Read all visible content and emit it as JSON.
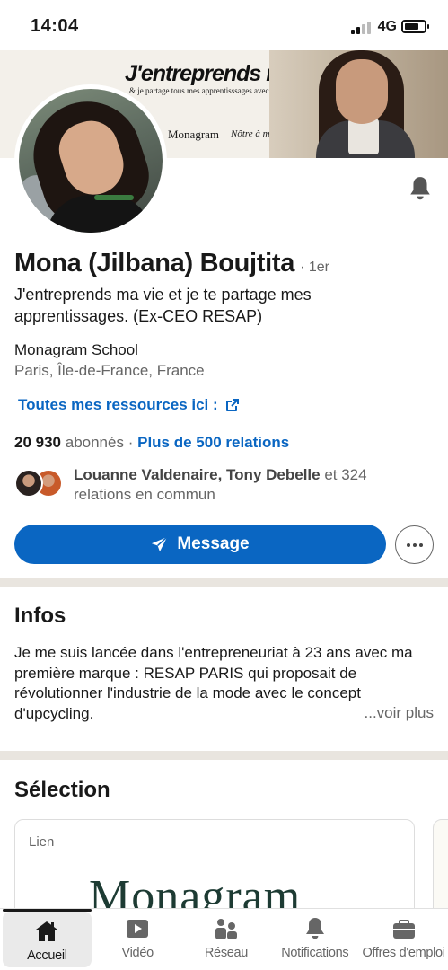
{
  "status_bar": {
    "time": "14:04",
    "network": "4G"
  },
  "banner": {
    "title": "J'entreprends ma vie.",
    "subtitle": "& je partage tous mes apprentisssages avec toi.",
    "brand": "Monagram",
    "handwriting": "Nôtre à moi-même"
  },
  "profile": {
    "name": "Mona (Jilbana) Boujtita",
    "degree": "· 1er",
    "headline": "J'entreprends ma vie et je te partage mes apprentissages. (Ex-CEO RESAP)",
    "company": "Monagram School",
    "location": "Paris, Île-de-France, France",
    "link_label": "Toutes mes ressources ici :",
    "followers_count": "20 930",
    "followers_label": "abonnés",
    "separator": "·",
    "connections": "Plus de 500 relations",
    "mutual_names": "Louanne Valdenaire, Tony Debelle",
    "mutual_suffix": "et 324 relations en commun"
  },
  "actions": {
    "message_label": "Message"
  },
  "about": {
    "title": "Infos",
    "text": "Je me suis lancée dans l'entrepreneuriat à 23 ans avec ma première marque : RESAP PARIS qui proposait de révolutionner l'industrie de la mode avec le concept d'upcycling.",
    "see_more": "...voir plus"
  },
  "featured": {
    "title": "Sélection",
    "card_label": "Lien",
    "card_logo": "Monagram"
  },
  "nav": {
    "items": [
      {
        "label": "Accueil",
        "icon": "home-icon"
      },
      {
        "label": "Vidéo",
        "icon": "video-icon"
      },
      {
        "label": "Réseau",
        "icon": "network-icon"
      },
      {
        "label": "Notifications",
        "icon": "bell-icon"
      },
      {
        "label": "Offres d'emploi",
        "icon": "briefcase-icon"
      }
    ]
  },
  "colors": {
    "accent": "#0a66c2",
    "divider": "#e9e5df"
  }
}
